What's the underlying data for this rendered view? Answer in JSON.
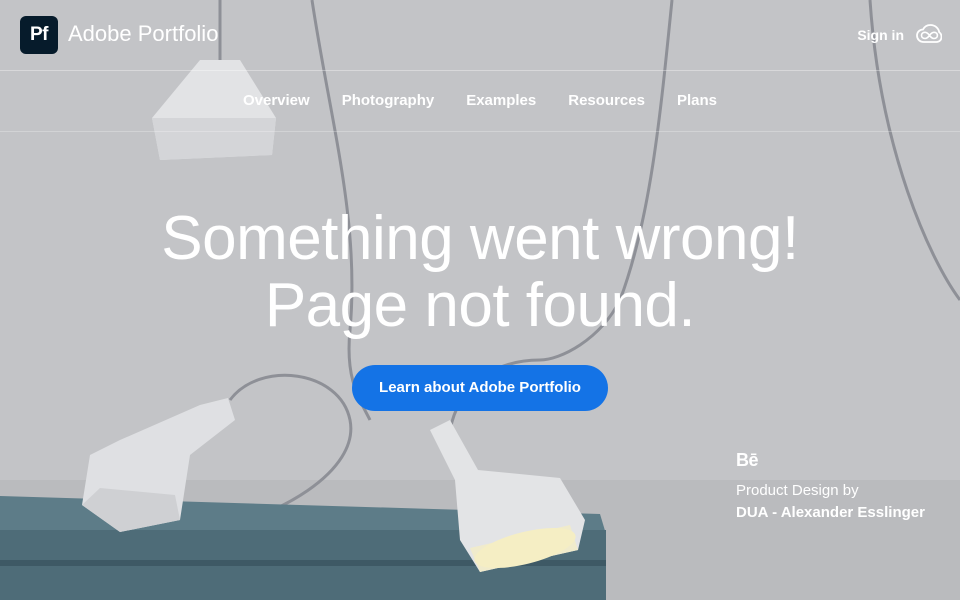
{
  "header": {
    "logo_text": "Pf",
    "brand_name": "Adobe Portfolio",
    "sign_in_label": "Sign in",
    "cc_icon": "creative-cloud-icon"
  },
  "nav": {
    "items": [
      {
        "label": "Overview"
      },
      {
        "label": "Photography"
      },
      {
        "label": "Examples"
      },
      {
        "label": "Resources"
      },
      {
        "label": "Plans"
      }
    ]
  },
  "hero": {
    "line1": "Something went wrong!",
    "line2": "Page not found."
  },
  "cta": {
    "label": "Learn about Adobe Portfolio"
  },
  "credit": {
    "platform_logo": "Bē",
    "line1": "Product Design by",
    "author": "DUA - Alexander Esslinger"
  },
  "colors": {
    "accent": "#1473e6",
    "logo_bg": "#061b2b",
    "text": "#ffffff"
  }
}
